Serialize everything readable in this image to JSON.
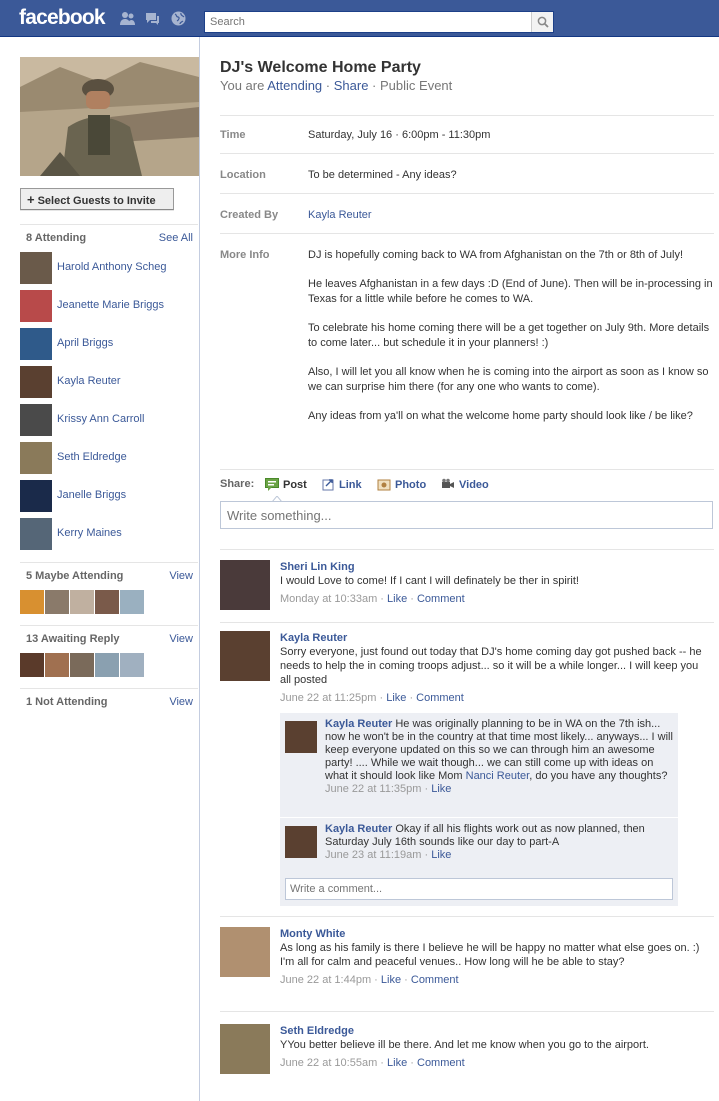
{
  "header": {
    "logo": "facebook",
    "search_placeholder": "Search"
  },
  "event": {
    "title": "DJ's Welcome Home Party",
    "status_prefix": "You are ",
    "status_link": "Attending",
    "share_link": "Share",
    "privacy": "Public Event",
    "separator": " · ",
    "invite_button": "Select Guests to Invite"
  },
  "info": {
    "time_label": "Time",
    "time_value": "Saturday, July 16 · 6:00pm - 11:30pm",
    "location_label": "Location",
    "location_value": "To be determined - Any ideas?",
    "created_label": "Created By",
    "created_value": "Kayla Reuter",
    "more_label": "More Info",
    "more_paragraphs": [
      "DJ is hopefully coming back to WA from Afghanistan on the 7th or 8th of July!",
      "He leaves Afghanistan in a few days :D (End of June). Then will be in-processing in Texas for a little while before he comes to WA.",
      "To celebrate his home coming there will be a get together on July 9th. More details to come later... but schedule it in your planners! :)",
      "Also, I will let you all know when he is coming into the airport as soon as I know so we can surprise him there (for any one who wants to come).",
      "Any ideas from ya'll on what the welcome home party should look like / be like?"
    ]
  },
  "guests": {
    "attending_title": "8 Attending",
    "see_all": "See All",
    "attending": [
      {
        "name": "Harold Anthony Scheg",
        "color": "#6a5a4a"
      },
      {
        "name": "Jeanette Marie Briggs",
        "color": "#b84a4a"
      },
      {
        "name": "April Briggs",
        "color": "#2f5a8a"
      },
      {
        "name": "Kayla Reuter",
        "color": "#5a4030"
      },
      {
        "name": "Krissy Ann Carroll",
        "color": "#4a4a4a"
      },
      {
        "name": "Seth Eldredge",
        "color": "#8a7a5a"
      },
      {
        "name": "Janelle Briggs",
        "color": "#1a2a4a"
      },
      {
        "name": "Kerry Maines",
        "color": "#556677"
      }
    ],
    "maybe_title": "5 Maybe Attending",
    "awaiting_title": "13 Awaiting Reply",
    "not_title": "1 Not Attending",
    "view": "View",
    "maybe_colors": [
      "#d89030",
      "#8a7a6a",
      "#c0b0a0",
      "#7a5a4a",
      "#9ab0c0"
    ],
    "awaiting_colors": [
      "#5a3a2a",
      "#a07050",
      "#7a6a5a",
      "#8aa0b0",
      "#a0b0c0"
    ]
  },
  "share": {
    "label": "Share:",
    "post": "Post",
    "link": "Link",
    "photo": "Photo",
    "video": "Video",
    "composer_placeholder": "Write something..."
  },
  "wall": {
    "dot": " · ",
    "like": "Like",
    "comment": "Comment",
    "posts": [
      {
        "name": "Sheri Lin King",
        "text": "I would Love to come! If I cant I will definately be ther in spirit!",
        "time": "Monday at 10:33am",
        "avatar_color": "#4a3a3a"
      },
      {
        "name": "Kayla Reuter",
        "text": "Sorry everyone, just found out today that DJ's home coming day got pushed back -- he needs to help the in coming troops adjust... so it will be a while longer... I will keep you all posted",
        "time": "June 22 at 11:25pm",
        "avatar_color": "#5a4030"
      },
      {
        "name": "Monty White",
        "text": "As long as his family is there I believe he will be happy no matter what else goes on. :) I'm all for calm and peaceful venues.. How long will he be able to stay?",
        "time": "June 22 at 1:44pm",
        "avatar_color": "#b09070"
      },
      {
        "name": "Seth Eldredge",
        "text": "YYou better believe ill be there. And let me know when you go to the airport.",
        "time": "June 22 at 10:55am",
        "avatar_color": "#8a7a5a"
      }
    ],
    "comments": [
      {
        "name": "Kayla Reuter",
        "text_before": "He was originally planning to be in WA on the 7th ish... now he won't be in the country at that time most likely... anyways... I will keep everyone updated on this so we can through him an awesome party! .... While we wait though... we can still come up with ideas on what it should look like Mom ",
        "mention": "Nanci Reuter",
        "text_after": ", do you have any thoughts?",
        "time": "June 22 at 11:35pm",
        "avatar_color": "#5a4030"
      },
      {
        "name": "Kayla Reuter",
        "text_before": "Okay if all his flights work out as now planned, then Saturday July 16th sounds like our day to part-A",
        "mention": "",
        "text_after": "",
        "time": "June 23 at 11:19am",
        "avatar_color": "#5a4030"
      }
    ],
    "reply_placeholder": "Write a comment..."
  }
}
